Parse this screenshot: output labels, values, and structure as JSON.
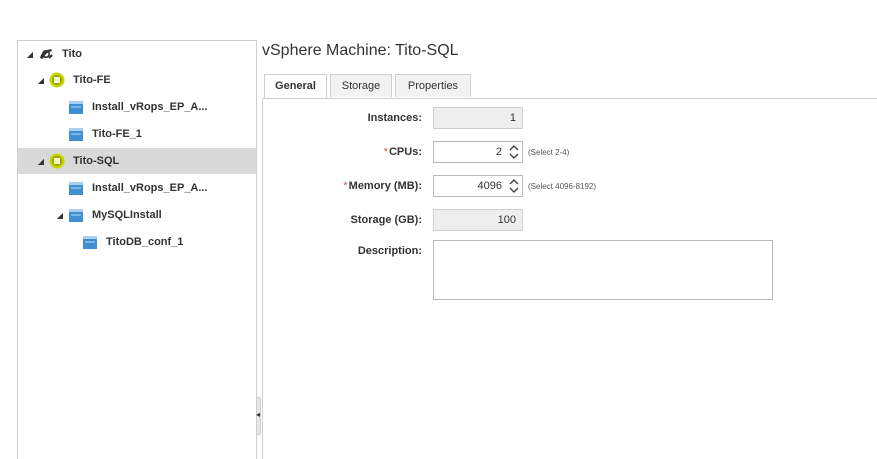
{
  "tree": {
    "items": [
      {
        "label": "Tito",
        "icon": "blueprint-icon",
        "toggle": "◢"
      },
      {
        "label": "Tito-FE",
        "icon": "vm-component-icon",
        "toggle": "◢"
      },
      {
        "label": "Install_vRops_EP_A...",
        "icon": "software-component-icon",
        "toggle": ""
      },
      {
        "label": "Tito-FE_1",
        "icon": "software-component-icon",
        "toggle": ""
      },
      {
        "label": "Tito-SQL",
        "icon": "vm-component-icon",
        "toggle": "◢"
      },
      {
        "label": "Install_vRops_EP_A...",
        "icon": "software-component-icon",
        "toggle": ""
      },
      {
        "label": "MySQLInstall",
        "icon": "software-component-icon",
        "toggle": "◢"
      },
      {
        "label": "TitoDB_conf_1",
        "icon": "software-component-icon",
        "toggle": ""
      }
    ],
    "collapse_glyph": "◂"
  },
  "detail": {
    "title": "vSphere Machine: Tito-SQL",
    "tabs": [
      {
        "label": "General"
      },
      {
        "label": "Storage"
      },
      {
        "label": "Properties"
      }
    ],
    "form": {
      "instances": {
        "label": "Instances:",
        "value": "1"
      },
      "cpus": {
        "label": "CPUs:",
        "required": "*",
        "value": "2",
        "hint": "(Select 2-4)",
        "spinner": "⌃⌄"
      },
      "memory": {
        "label": "Memory (MB):",
        "required": "*",
        "value": "4096",
        "hint": "(Select 4096-8192)",
        "spinner": "⌃⌄"
      },
      "storage": {
        "label": "Storage (GB):",
        "value": "100"
      },
      "description": {
        "label": "Description:",
        "value": ""
      }
    }
  },
  "colors": {
    "selected_row": "#d9d9d9",
    "required_marker": "#d9534f",
    "vm_icon_fill": "#c8d400",
    "software_icon_fill": "#3f8fd2"
  }
}
